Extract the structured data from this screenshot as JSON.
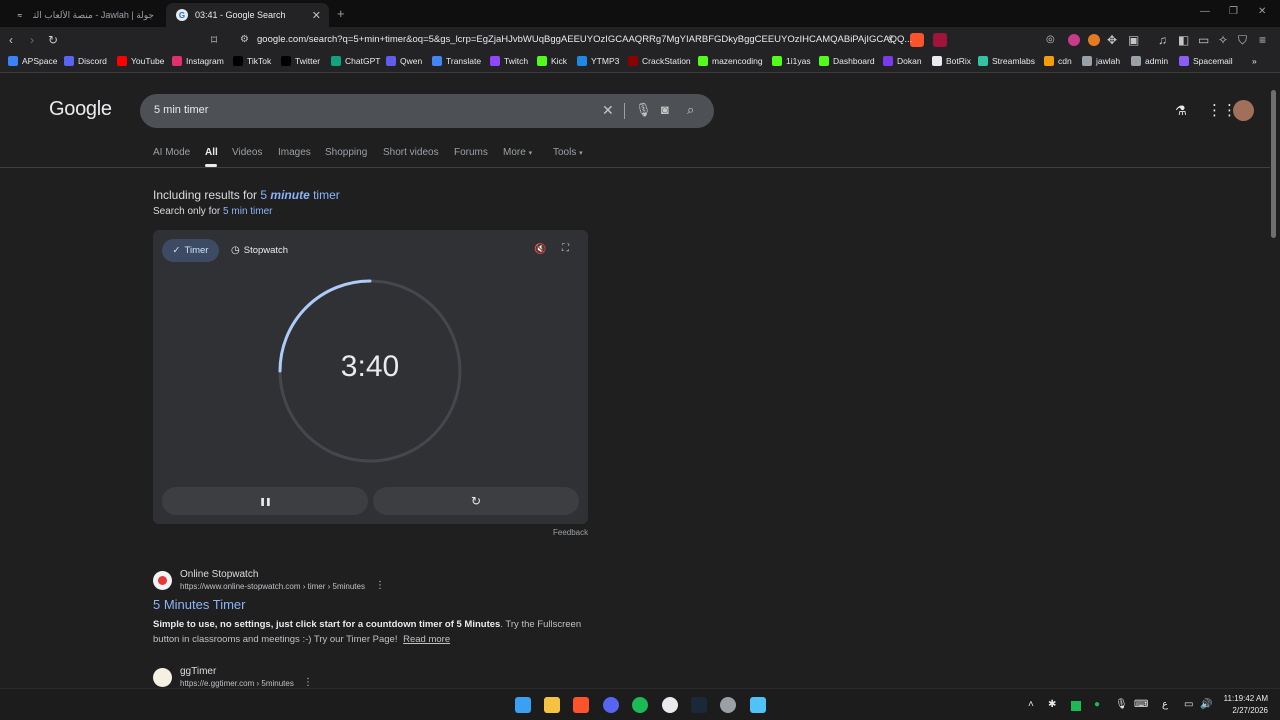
{
  "tabs": [
    {
      "title": "جولة | Jawlah - منصة الألعاب التفاعلية",
      "active": false
    },
    {
      "title": "03:41 - Google Search",
      "active": true
    }
  ],
  "url": "google.com/search?q=5+min+timer&oq=5&gs_lcrp=EgZjaHJvbWUqBggAEEUYOzIGCAAQRRg7MgYIARBFGDkyBggCEEUYOzIHCAMQABiPAjIGCAQQ...",
  "bookmarks": [
    {
      "label": "APSpace",
      "color": "#3b82f6"
    },
    {
      "label": "Discord",
      "color": "#5865f2"
    },
    {
      "label": "YouTube",
      "color": "#ff0000"
    },
    {
      "label": "Instagram",
      "color": "#e1306c"
    },
    {
      "label": "TikTok",
      "color": "#000000"
    },
    {
      "label": "Twitter",
      "color": "#000000"
    },
    {
      "label": "ChatGPT",
      "color": "#10a37f"
    },
    {
      "label": "Qwen",
      "color": "#615ced"
    },
    {
      "label": "Translate",
      "color": "#4285f4"
    },
    {
      "label": "Twitch",
      "color": "#9146ff"
    },
    {
      "label": "Kick",
      "color": "#53fc18"
    },
    {
      "label": "YTMP3",
      "color": "#1e88e5"
    },
    {
      "label": "CrackStation",
      "color": "#8b0000"
    },
    {
      "label": "mazencoding",
      "color": "#53fc18"
    },
    {
      "label": "1i1yas",
      "color": "#53fc18"
    },
    {
      "label": "Dashboard",
      "color": "#53fc18"
    },
    {
      "label": "Dokan",
      "color": "#7c3aed"
    },
    {
      "label": "BotRix",
      "color": "#e8eaed"
    },
    {
      "label": "Streamlabs",
      "color": "#31c3a2"
    },
    {
      "label": "cdn",
      "color": "#f59e0b"
    },
    {
      "label": "jawlah",
      "color": "#9aa0a6"
    },
    {
      "label": "admin",
      "color": "#9aa0a6"
    },
    {
      "label": "Spacemail",
      "color": "#8b5cf6"
    }
  ],
  "google": {
    "logo": "Google",
    "query": "5 min timer",
    "nav": [
      "AI Mode",
      "All",
      "Videos",
      "Images",
      "Shopping",
      "Short videos",
      "Forums",
      "More",
      "Tools"
    ],
    "including_prefix": "Including results for ",
    "including_num": "5 ",
    "including_word": "minute",
    "including_suffix": " timer",
    "search_only_prefix": "Search only for ",
    "search_only_link": "5 min timer"
  },
  "timer": {
    "mode_timer": "Timer",
    "mode_stopwatch": "Stopwatch",
    "time": "3:40",
    "remaining_fraction": 0.733,
    "pause_glyph": "❚❚",
    "reset_glyph": "↻",
    "feedback": "Feedback"
  },
  "results": [
    {
      "site": "Online Stopwatch",
      "url": "https://www.online-stopwatch.com › timer › 5minutes",
      "title": "5 Minutes Timer",
      "snippet_bold": "Simple to use, no settings, just click start for a countdown timer of 5 Minutes",
      "snippet_rest": ". Try the Fullscreen button in classrooms and meetings :-) Try our Timer Page!",
      "read_more": "Read more"
    },
    {
      "site": "ggTimer",
      "url": "https://e.ggtimer.com › 5minutes"
    }
  ],
  "clock": {
    "time": "11:19:42 AM",
    "date": "2/27/2026"
  },
  "lang": "ع"
}
